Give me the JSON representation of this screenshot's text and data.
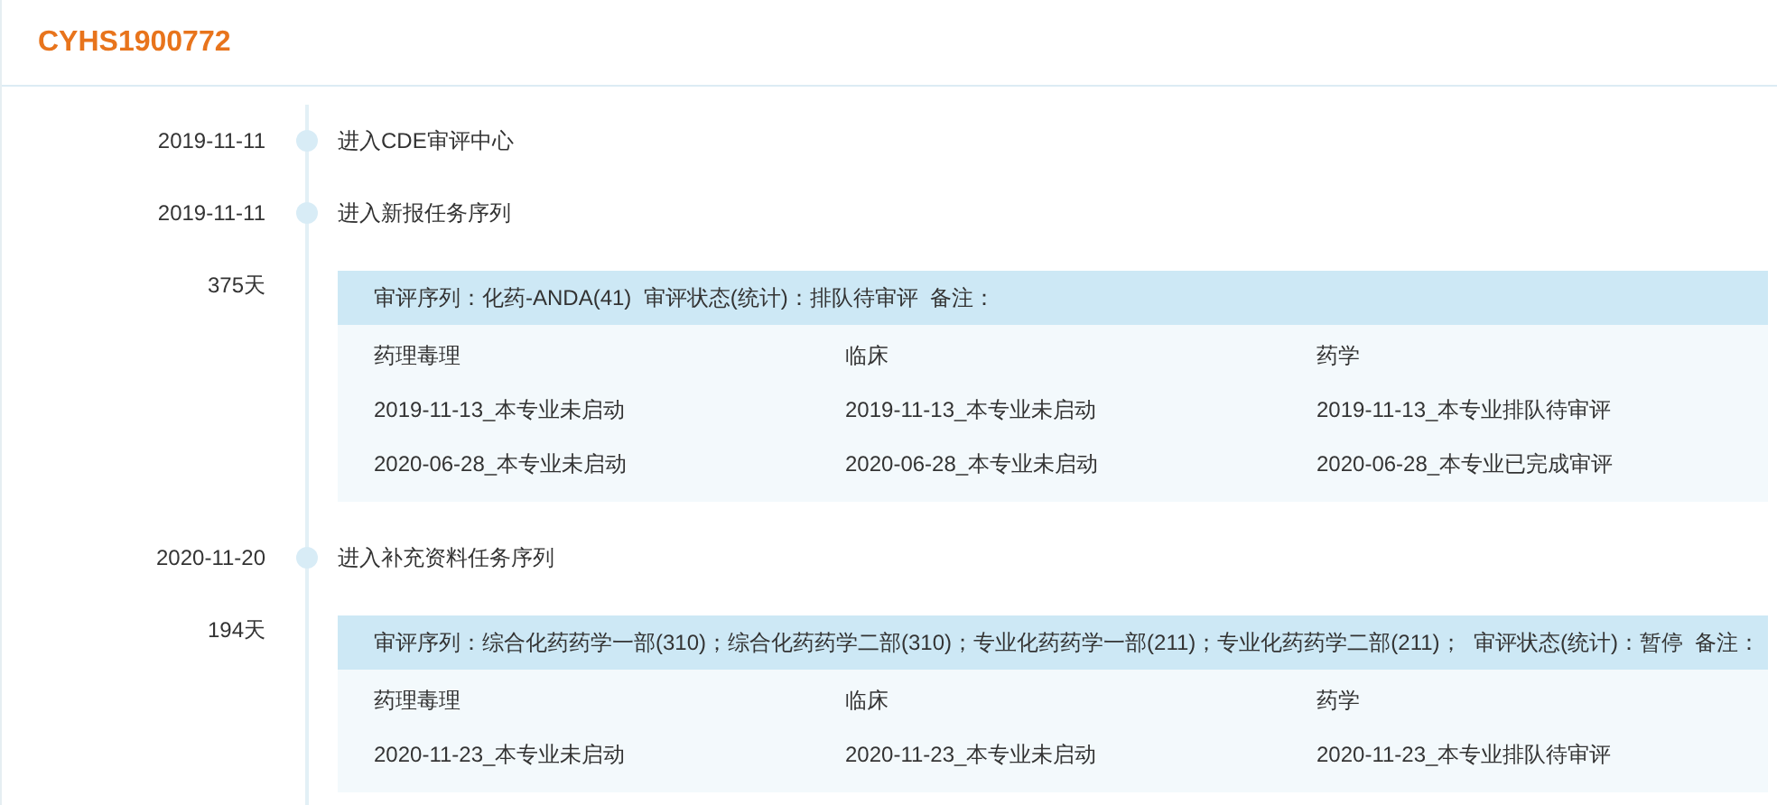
{
  "title": "CYHS1900772",
  "timeline": [
    {
      "kind": "event",
      "date": "2019-11-11",
      "text": "进入CDE审评中心"
    },
    {
      "kind": "event",
      "date": "2019-11-11",
      "text": "进入新报任务序列"
    },
    {
      "kind": "duration",
      "label": "375天",
      "panel": {
        "header": "审评序列：化药-ANDA(41)  审评状态(统计)：排队待审评  备注：",
        "columns": [
          {
            "heading": "药理毒理",
            "lines": [
              "2019-11-13_本专业未启动",
              "2020-06-28_本专业未启动"
            ]
          },
          {
            "heading": "临床",
            "lines": [
              "2019-11-13_本专业未启动",
              "2020-06-28_本专业未启动"
            ]
          },
          {
            "heading": "药学",
            "lines": [
              "2019-11-13_本专业排队待审评",
              "2020-06-28_本专业已完成审评"
            ]
          }
        ]
      }
    },
    {
      "kind": "event",
      "date": "2020-11-20",
      "text": "进入补充资料任务序列"
    },
    {
      "kind": "duration",
      "label": "194天",
      "panel": {
        "header": "审评序列：综合化药药学一部(310)；综合化药药学二部(310)；专业化药药学一部(211)；专业化药药学二部(211)；  审评状态(统计)：暂停  备注：",
        "columns": [
          {
            "heading": "药理毒理",
            "lines": [
              "2020-11-23_本专业未启动"
            ]
          },
          {
            "heading": "临床",
            "lines": [
              "2020-11-23_本专业未启动"
            ]
          },
          {
            "heading": "药学",
            "lines": [
              "2020-11-23_本专业排队待审评"
            ]
          }
        ]
      }
    }
  ]
}
